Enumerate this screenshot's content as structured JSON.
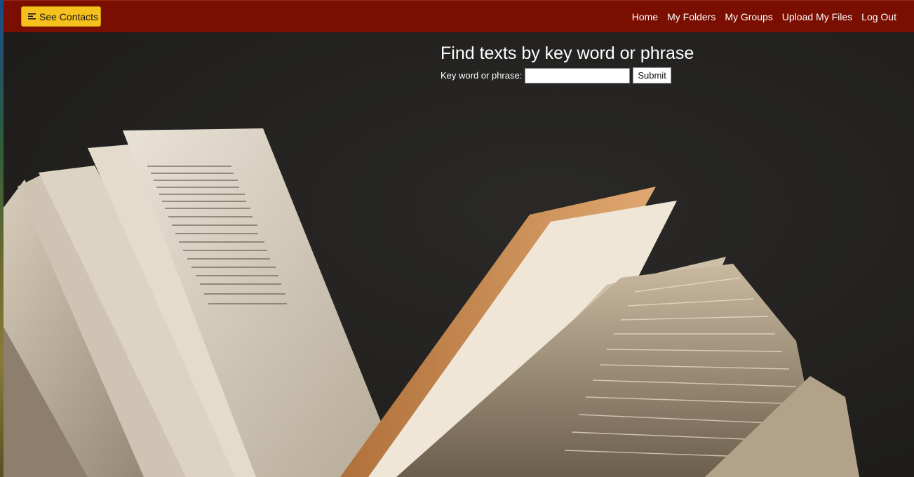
{
  "navbar": {
    "contacts_button": {
      "label": "See Contacts",
      "icon": "menu-lines-icon"
    },
    "links": [
      {
        "label": "Home"
      },
      {
        "label": "My Folders"
      },
      {
        "label": "My Groups"
      },
      {
        "label": "Upload My Files"
      },
      {
        "label": "Log Out"
      }
    ]
  },
  "search": {
    "title": "Find texts by key word or phrase",
    "label": "Key word or phrase:",
    "input_value": "",
    "submit_label": "Submit"
  },
  "colors": {
    "navbar_bg": "#7a0e00",
    "contacts_button_bg": "#f6c11c",
    "page_bg": "#242321"
  },
  "background_image": "open-book-pages-photo"
}
